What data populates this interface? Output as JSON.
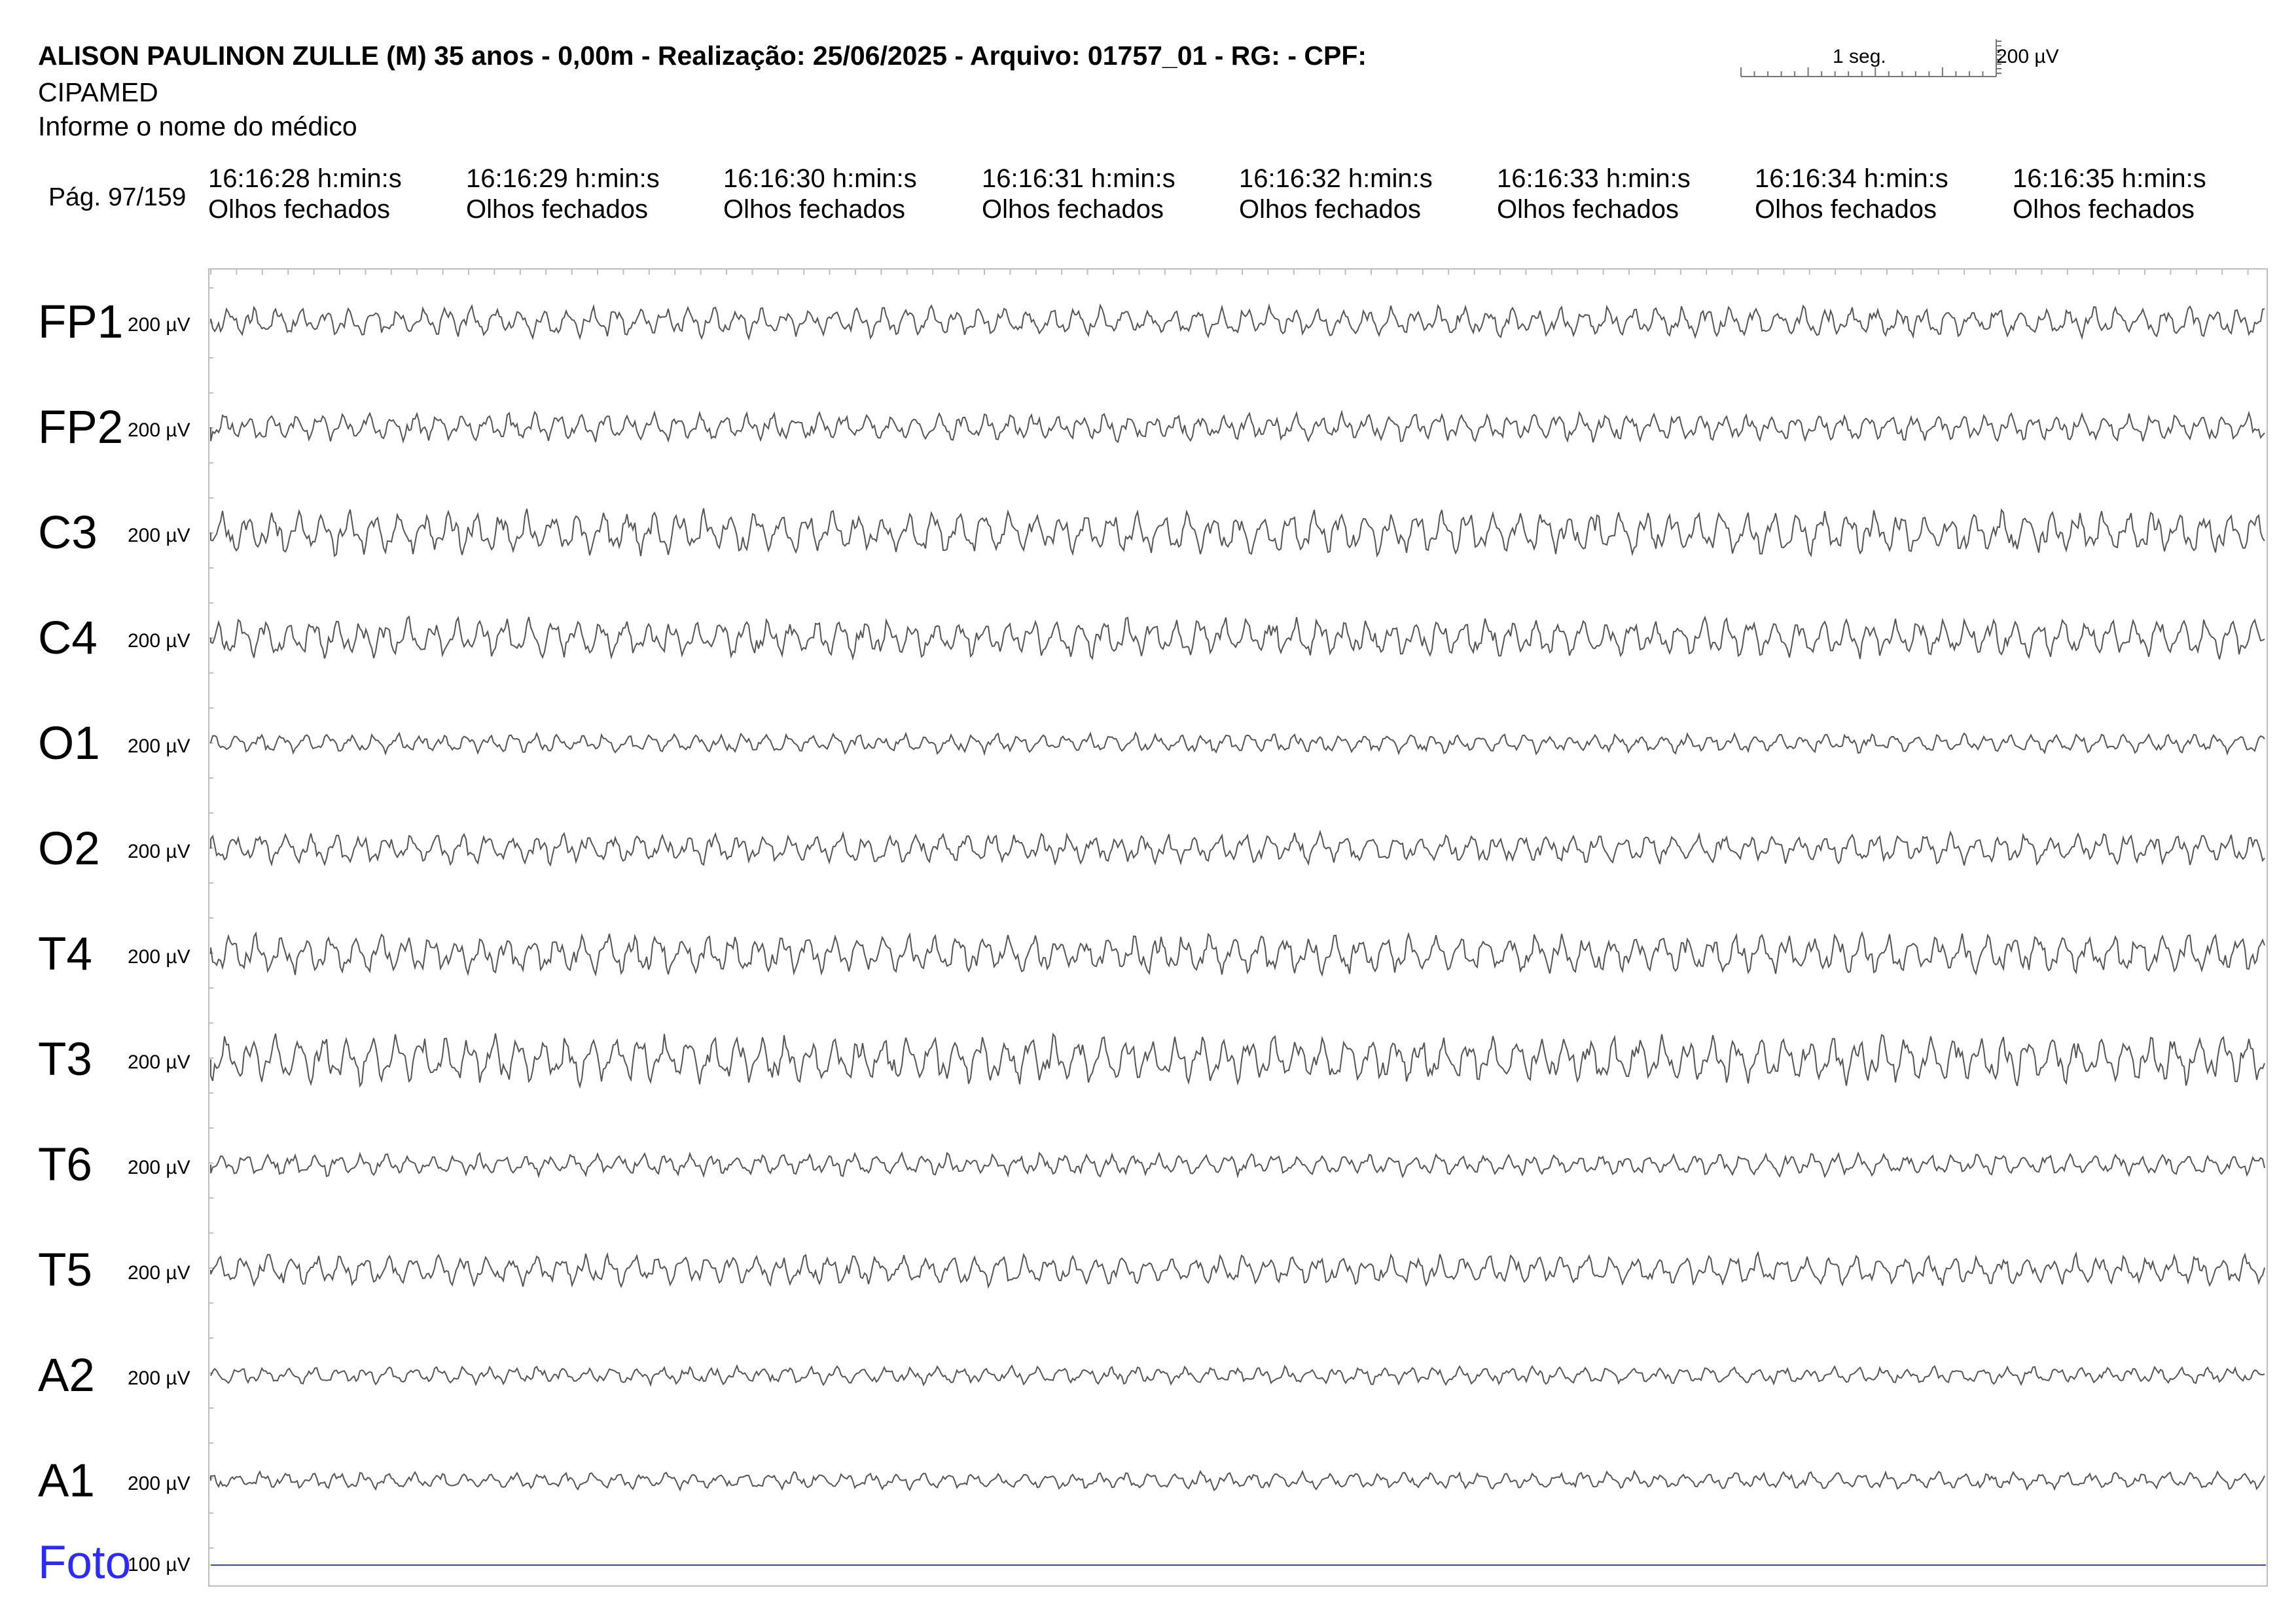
{
  "header": {
    "title": "ALISON PAULINON ZULLE (M) 35 anos - 0,00m - Realização: 25/06/2025 - Arquivo: 01757_01 - RG:  - CPF:",
    "organization": "CIPAMED",
    "doctor": "Informe o nome do médico",
    "page": "Pág. 97/159"
  },
  "scale": {
    "time_label": "1 seg.",
    "amplitude_label": "200 µV"
  },
  "timestamps": [
    {
      "time": "16:16:28 h:min:s",
      "state": "Olhos fechados"
    },
    {
      "time": "16:16:29 h:min:s",
      "state": "Olhos fechados"
    },
    {
      "time": "16:16:30 h:min:s",
      "state": "Olhos fechados"
    },
    {
      "time": "16:16:31 h:min:s",
      "state": "Olhos fechados"
    },
    {
      "time": "16:16:32 h:min:s",
      "state": "Olhos fechados"
    },
    {
      "time": "16:16:33 h:min:s",
      "state": "Olhos fechados"
    },
    {
      "time": "16:16:34 h:min:s",
      "state": "Olhos fechados"
    },
    {
      "time": "16:16:35 h:min:s",
      "state": "Olhos fechados"
    }
  ],
  "channels": [
    {
      "name": "FP1",
      "sensitivity": "200 µV"
    },
    {
      "name": "FP2",
      "sensitivity": "200 µV"
    },
    {
      "name": "C3",
      "sensitivity": "200 µV"
    },
    {
      "name": "C4",
      "sensitivity": "200 µV"
    },
    {
      "name": "O1",
      "sensitivity": "200 µV"
    },
    {
      "name": "O2",
      "sensitivity": "200 µV"
    },
    {
      "name": "T4",
      "sensitivity": "200 µV"
    },
    {
      "name": "T3",
      "sensitivity": "200 µV"
    },
    {
      "name": "T6",
      "sensitivity": "200 µV"
    },
    {
      "name": "T5",
      "sensitivity": "200 µV"
    },
    {
      "name": "A2",
      "sensitivity": "200 µV"
    },
    {
      "name": "A1",
      "sensitivity": "200 µV"
    },
    {
      "name": "Foto",
      "sensitivity": "100 µV"
    }
  ],
  "colors": {
    "trace": "#555555",
    "photic": "#3b3bff",
    "frame": "#bdbdbd"
  }
}
